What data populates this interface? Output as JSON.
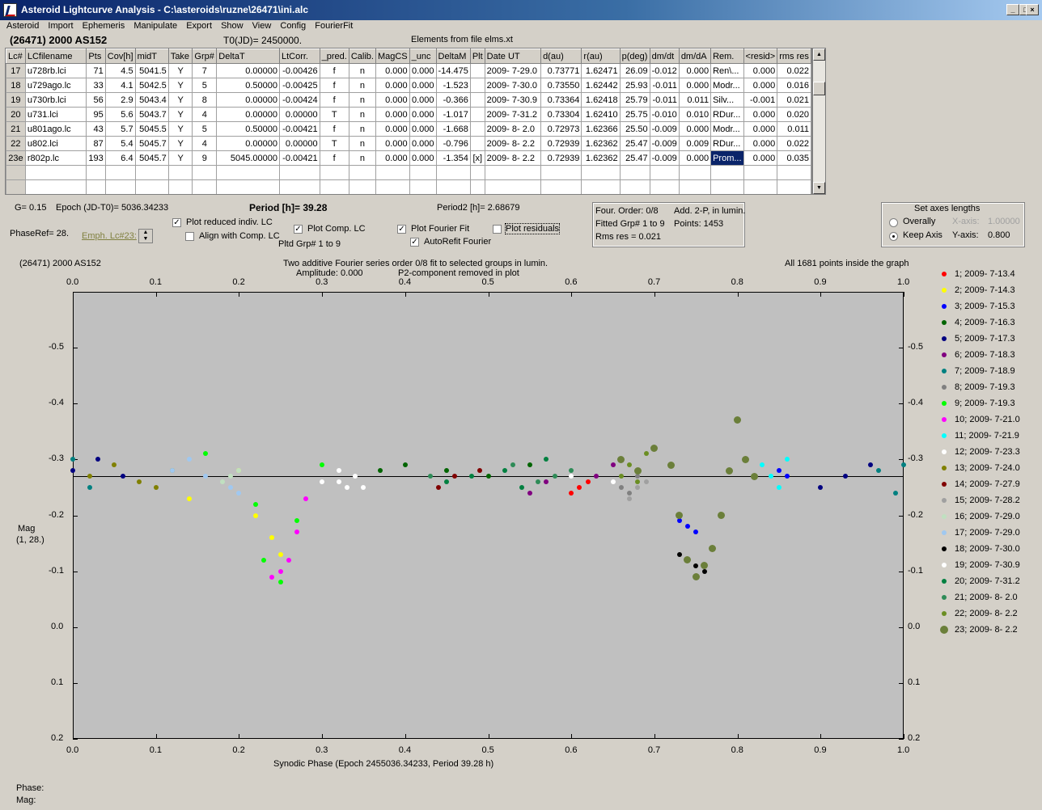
{
  "window": {
    "title": "Asteroid Lightcurve Analysis - C:\\asteroids\\ruzne\\26471\\ini.alc",
    "btn_min": "_",
    "btn_max": "□",
    "btn_close": "×"
  },
  "menu": [
    "Asteroid",
    "Import",
    "Ephemeris",
    "Manipulate",
    "Export",
    "Show",
    "View",
    "Config",
    "FourierFit"
  ],
  "header": {
    "asteroid": "(26471) 2000 AS152",
    "t0": "T0(JD)= 2450000.",
    "elements": "Elements from file elms.xt"
  },
  "table": {
    "columns": [
      "Lc#",
      "LCfilename",
      "Pts",
      "Cov[h]",
      "midT",
      "Take",
      "Grp#",
      "DeltaT",
      "LtCorr.",
      "_pred.",
      "Calib.",
      "MagCS",
      "_unc",
      "DeltaM",
      "Plt",
      "Date UT",
      "d(au)",
      "r(au)",
      "p(deg)",
      "dm/dt",
      "dm/dA",
      "Rem.",
      "<resid>",
      "rms res"
    ],
    "rows": [
      [
        "17",
        "u728rb.lci",
        "71",
        "4.5",
        "5041.5",
        "Y",
        "7",
        "0.00000",
        "-0.00426",
        "f",
        "n",
        "0.000",
        "0.000",
        "-14.475",
        "",
        "2009- 7-29.0",
        "0.73771",
        "1.62471",
        "26.09",
        "-0.012",
        "0.000",
        "Ren\\...",
        "0.000",
        "0.022"
      ],
      [
        "18",
        "u729ago.lc",
        "33",
        "4.1",
        "5042.5",
        "Y",
        "5",
        "0.50000",
        "-0.00425",
        "f",
        "n",
        "0.000",
        "0.000",
        "-1.523",
        "",
        "2009- 7-30.0",
        "0.73550",
        "1.62442",
        "25.93",
        "-0.011",
        "0.000",
        "Modr...",
        "0.000",
        "0.016"
      ],
      [
        "19",
        "u730rb.lci",
        "56",
        "2.9",
        "5043.4",
        "Y",
        "8",
        "0.00000",
        "-0.00424",
        "f",
        "n",
        "0.000",
        "0.000",
        "-0.366",
        "",
        "2009- 7-30.9",
        "0.73364",
        "1.62418",
        "25.79",
        "-0.011",
        "0.011",
        "Silv...",
        "-0.001",
        "0.021"
      ],
      [
        "20",
        "u731.lci",
        "95",
        "5.6",
        "5043.7",
        "Y",
        "4",
        "0.00000",
        "0.00000",
        "T",
        "n",
        "0.000",
        "0.000",
        "-1.017",
        "",
        "2009- 7-31.2",
        "0.73304",
        "1.62410",
        "25.75",
        "-0.010",
        "0.010",
        "RDur...",
        "0.000",
        "0.020"
      ],
      [
        "21",
        "u801ago.lc",
        "43",
        "5.7",
        "5045.5",
        "Y",
        "5",
        "0.50000",
        "-0.00421",
        "f",
        "n",
        "0.000",
        "0.000",
        "-1.668",
        "",
        "2009- 8- 2.0",
        "0.72973",
        "1.62366",
        "25.50",
        "-0.009",
        "0.000",
        "Modr...",
        "0.000",
        "0.011"
      ],
      [
        "22",
        "u802.lci",
        "87",
        "5.4",
        "5045.7",
        "Y",
        "4",
        "0.00000",
        "0.00000",
        "T",
        "n",
        "0.000",
        "0.000",
        "-0.796",
        "",
        "2009- 8- 2.2",
        "0.72939",
        "1.62362",
        "25.47",
        "-0.009",
        "0.009",
        "RDur...",
        "0.000",
        "0.022"
      ],
      [
        "23e",
        "r802p.lc",
        "193",
        "6.4",
        "5045.7",
        "Y",
        "9",
        "5045.00000",
        "-0.00421",
        "f",
        "n",
        "0.000",
        "0.000",
        "-1.354",
        "[x]",
        "2009- 8- 2.2",
        "0.72939",
        "1.62362",
        "25.47",
        "-0.009",
        "0.000",
        "Prom...",
        "0.000",
        "0.035"
      ]
    ]
  },
  "controls": {
    "g": "G= 0.15",
    "epoch": "Epoch (JD-T0)= 5036.34233",
    "period": "Period [h]= 39.28",
    "period2": "Period2 [h]= 2.68679",
    "phaseref": "PhaseRef= 28.",
    "emph": "Emph. Lc#23:",
    "plot_reduced": "Plot reduced indiv. LC",
    "align_comp": "Align with Comp. LC",
    "plot_comp": "Plot Comp. LC",
    "pltd_grp": "Pltd Grp#  1   to   9",
    "plot_fourier": "Plot Fourier Fit",
    "autorefit": "AutoRefit Fourier",
    "plot_residuals": "Plot residuals",
    "four_order": "Four. Order:  0/8",
    "add2p": "Add. 2-P, in lumin.",
    "fitted": "Fitted Grp# 1 to 9",
    "points": "Points: 1453",
    "rms": "Rms res      = 0.021",
    "axes_title": "Set axes lengths",
    "overally": "Overally",
    "keep_axis": "Keep Axis",
    "xaxis_lbl": "X-axis:",
    "xaxis_val": "1.00000",
    "yaxis_lbl": "Y-axis:",
    "yaxis_val": "0.800"
  },
  "plot": {
    "name": "(26471) 2000 AS152",
    "desc1": "Two additive Fourier series order 0/8 fit to selected groups in lumin.",
    "desc2": "Amplitude: 0.000",
    "desc3": "P2-component removed in plot",
    "inside": "All 1681 points inside the graph",
    "ylabel1": "Mag",
    "ylabel2": "(1, 28.)",
    "xlabel": "Synodic Phase (Epoch 2455036.34233, Period 39.28 h)",
    "phase_lbl": "Phase:",
    "mag_lbl": "Mag:"
  },
  "chart_data": {
    "type": "scatter",
    "xlabel": "Synodic Phase (Epoch 2455036.34233, Period 39.28 h)",
    "ylabel": "Mag (1, 28.)",
    "xlim": [
      0.0,
      1.0
    ],
    "ylim": [
      -0.6,
      0.2
    ],
    "y_inverted": true,
    "xticks": [
      "0.0",
      "0.1",
      "0.2",
      "0.3",
      "0.4",
      "0.5",
      "0.6",
      "0.7",
      "0.8",
      "0.9",
      "1.0"
    ],
    "yticks": [
      "-0.5",
      "-0.4",
      "-0.3",
      "-0.2",
      "-0.1",
      "0.0",
      "0.1",
      "0.2"
    ],
    "fit_line_y": -0.27,
    "series": [
      {
        "name": "1; 2009- 7-13.4",
        "color": "#ff0000",
        "x": [
          0.6,
          0.61,
          0.62
        ],
        "y": [
          -0.24,
          -0.25,
          -0.26
        ]
      },
      {
        "name": "2; 2009- 7-14.3",
        "color": "#ffff00",
        "x": [
          0.14,
          0.2,
          0.22,
          0.24,
          0.25
        ],
        "y": [
          -0.23,
          -0.28,
          -0.2,
          -0.16,
          -0.13
        ]
      },
      {
        "name": "3; 2009- 7-15.3",
        "color": "#0000ff",
        "x": [
          0.73,
          0.74,
          0.75,
          0.85,
          0.86
        ],
        "y": [
          -0.19,
          -0.18,
          -0.17,
          -0.28,
          -0.27
        ]
      },
      {
        "name": "4; 2009- 7-16.3",
        "color": "#006400",
        "x": [
          0.37,
          0.4,
          0.45,
          0.5,
          0.55
        ],
        "y": [
          -0.28,
          -0.29,
          -0.28,
          -0.27,
          -0.29
        ]
      },
      {
        "name": "5; 2009- 7-17.3",
        "color": "#000080",
        "x": [
          0.0,
          0.03,
          0.06,
          0.9,
          0.93,
          0.96
        ],
        "y": [
          -0.28,
          -0.3,
          -0.27,
          -0.25,
          -0.27,
          -0.29
        ]
      },
      {
        "name": "6; 2009- 7-18.3",
        "color": "#800080",
        "x": [
          0.55,
          0.57,
          0.63,
          0.65
        ],
        "y": [
          -0.24,
          -0.26,
          -0.27,
          -0.29
        ]
      },
      {
        "name": "7; 2009- 7-18.9",
        "color": "#008080",
        "x": [
          0.0,
          0.02,
          0.97,
          0.99,
          1.0
        ],
        "y": [
          -0.3,
          -0.25,
          -0.28,
          -0.24,
          -0.29
        ]
      },
      {
        "name": "8; 2009- 7-19.3",
        "color": "#808080",
        "x": [
          0.66,
          0.67,
          0.68
        ],
        "y": [
          -0.25,
          -0.24,
          -0.27
        ]
      },
      {
        "name": "9; 2009- 7-19.3",
        "color": "#00ff00",
        "x": [
          0.16,
          0.22,
          0.23,
          0.25,
          0.27,
          0.3
        ],
        "y": [
          -0.31,
          -0.22,
          -0.12,
          -0.08,
          -0.19,
          -0.29
        ]
      },
      {
        "name": "10; 2009- 7-21.0",
        "color": "#ff00ff",
        "x": [
          0.24,
          0.25,
          0.26,
          0.27,
          0.28
        ],
        "y": [
          -0.09,
          -0.1,
          -0.12,
          -0.17,
          -0.23
        ]
      },
      {
        "name": "11; 2009- 7-21.9",
        "color": "#00ffff",
        "x": [
          0.83,
          0.84,
          0.85,
          0.86
        ],
        "y": [
          -0.29,
          -0.27,
          -0.25,
          -0.3
        ]
      },
      {
        "name": "12; 2009- 7-23.3",
        "color": "#ffffff",
        "x": [
          0.3,
          0.32,
          0.35,
          0.6,
          0.65
        ],
        "y": [
          -0.26,
          -0.28,
          -0.25,
          -0.27,
          -0.26
        ]
      },
      {
        "name": "13; 2009- 7-24.0",
        "color": "#808000",
        "x": [
          0.02,
          0.05,
          0.08,
          0.1,
          0.12
        ],
        "y": [
          -0.27,
          -0.29,
          -0.26,
          -0.25,
          -0.28
        ]
      },
      {
        "name": "14; 2009- 7-27.9",
        "color": "#800000",
        "x": [
          0.44,
          0.46,
          0.49
        ],
        "y": [
          -0.25,
          -0.27,
          -0.28
        ]
      },
      {
        "name": "15; 2009- 7-28.2",
        "color": "#a0a0a0",
        "x": [
          0.67,
          0.68,
          0.69
        ],
        "y": [
          -0.23,
          -0.25,
          -0.26
        ]
      },
      {
        "name": "16; 2009- 7-29.0",
        "color": "#c0e0c0",
        "x": [
          0.18,
          0.19,
          0.2
        ],
        "y": [
          -0.26,
          -0.27,
          -0.28
        ]
      },
      {
        "name": "17; 2009- 7-29.0",
        "color": "#a0c8f0",
        "x": [
          0.12,
          0.14,
          0.16,
          0.19,
          0.2
        ],
        "y": [
          -0.28,
          -0.3,
          -0.27,
          -0.25,
          -0.24
        ]
      },
      {
        "name": "18; 2009- 7-30.0",
        "color": "#000000",
        "x": [
          0.73,
          0.75,
          0.76
        ],
        "y": [
          -0.13,
          -0.11,
          -0.1
        ]
      },
      {
        "name": "19; 2009- 7-30.9",
        "color": "#ffffff",
        "x": [
          0.32,
          0.33,
          0.34
        ],
        "y": [
          -0.26,
          -0.25,
          -0.27
        ]
      },
      {
        "name": "20; 2009- 7-31.2",
        "color": "#008040",
        "x": [
          0.45,
          0.48,
          0.52,
          0.54,
          0.57
        ],
        "y": [
          -0.26,
          -0.27,
          -0.28,
          -0.25,
          -0.3
        ]
      },
      {
        "name": "21; 2009- 8- 2.0",
        "color": "#2e8b57",
        "x": [
          0.43,
          0.53,
          0.56,
          0.58,
          0.6
        ],
        "y": [
          -0.27,
          -0.29,
          -0.26,
          -0.27,
          -0.28
        ]
      },
      {
        "name": "22; 2009- 8- 2.2",
        "color": "#6b8e23",
        "x": [
          0.66,
          0.67,
          0.68,
          0.69
        ],
        "y": [
          -0.27,
          -0.29,
          -0.26,
          -0.31
        ]
      },
      {
        "name": "23; 2009- 8- 2.2",
        "color": "#6b7f3a",
        "big": true,
        "x": [
          0.66,
          0.68,
          0.7,
          0.72,
          0.73,
          0.74,
          0.75,
          0.76,
          0.77,
          0.78,
          0.79,
          0.8,
          0.81,
          0.82
        ],
        "y": [
          -0.3,
          -0.28,
          -0.32,
          -0.29,
          -0.2,
          -0.12,
          -0.09,
          -0.11,
          -0.14,
          -0.2,
          -0.28,
          -0.37,
          -0.3,
          -0.27
        ]
      }
    ]
  }
}
